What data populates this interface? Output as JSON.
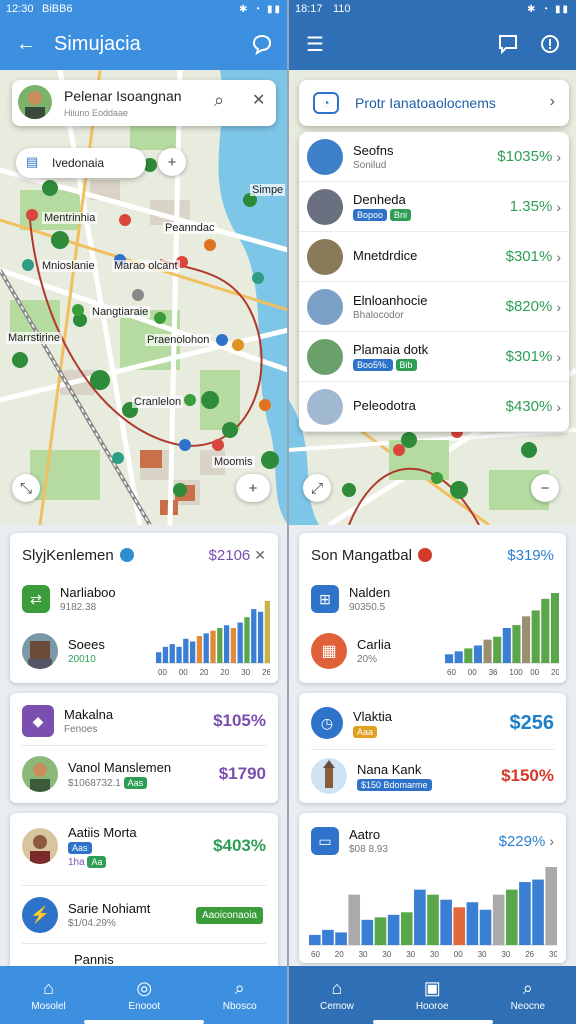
{
  "left": {
    "status": {
      "time": "12:30",
      "carrier": "BiBB6"
    },
    "appbar": {
      "title": "Simujacia"
    },
    "map": {
      "search_card": {
        "title": "Pelenar Isoangnan",
        "subtitle": "Hiiuno Eoddaae"
      },
      "filter_chip": {
        "label": "Ivedonaia"
      },
      "labels": [
        "Mentrinhia",
        "Peanndac",
        "Mnioslanie",
        "Marao olcant",
        "Nangtiaraie",
        "Marrstirine",
        "Praenolohon",
        "Cranlelon",
        "Moomis",
        "Simpe"
      ]
    },
    "list": [
      {
        "title": "SlyjKenlemen",
        "value": "$2106",
        "accent": "#7a4fb0",
        "rows": [
          {
            "title": "Narliaboo",
            "subtitle": "9182.38"
          },
          {
            "title": "Soees",
            "subtitle": "20010"
          }
        ],
        "chart_data": {
          "type": "bar",
          "series_colors": [
            "#3b7fd4",
            "#3b7fd4",
            "#3b7fd4",
            "#3b7fd4",
            "#3b7fd4",
            "#3b7fd4",
            "#e08a3c",
            "#3b7fd4",
            "#e08a3c",
            "#5aa64a",
            "#3b7fd4",
            "#e08a3c",
            "#3b7fd4",
            "#5aa64a",
            "#3b7fd4",
            "#3b7fd4",
            "#c9b24a"
          ],
          "values": [
            8,
            12,
            14,
            12,
            18,
            16,
            20,
            22,
            24,
            26,
            28,
            26,
            30,
            34,
            40,
            38,
            46
          ],
          "x_ticks": [
            "00",
            "00",
            "20",
            "20",
            "30",
            "26"
          ]
        }
      },
      {
        "title": "Makalna",
        "subtitle": "Fenoes",
        "value": "$105%",
        "accent": "#7a4fb0",
        "rows": [
          {
            "title": "Vanol Manslemen",
            "subtitle": "$1068732.1",
            "badge": "Aas",
            "value": "$1790"
          }
        ]
      },
      {
        "title": "Aatiis Morta",
        "value": "$403%",
        "accent": "#2e9e56",
        "badges": [
          "Aas",
          "Aa"
        ],
        "subtitle": "1ha",
        "rows": [
          {
            "title": "Sarie Nohiamt",
            "subtitle": "$1/04.29%",
            "pill": "Aaoiconaoia"
          },
          {
            "title": "Pannis",
            "subtitle": ""
          }
        ]
      }
    ],
    "nav": [
      {
        "label": "Mosolel",
        "icon": "home-icon"
      },
      {
        "label": "Enooot",
        "icon": "circle-icon"
      },
      {
        "label": "Nbosco",
        "icon": "search-icon"
      }
    ]
  },
  "right": {
    "status": {
      "time": "18:17",
      "carrier": "110"
    },
    "panel_header": {
      "title": "Protr Ianatoaolocnems"
    },
    "panel_items": [
      {
        "title": "Seofns",
        "subtitle": "Sonilud",
        "value": "$1035%",
        "color": "#2e9e56"
      },
      {
        "title": "Denheda",
        "badges": [
          "Bopoo",
          "Bni"
        ],
        "value": "1.35%",
        "color": "#2e9e56"
      },
      {
        "title": "Mnetdrdice",
        "subtitle": "",
        "value": "$301%",
        "color": "#2e9e56"
      },
      {
        "title": "Elnloanhocie",
        "subtitle": "Bhalocodor",
        "value": "$820%",
        "color": "#2e9e56"
      },
      {
        "title": "Plamaia dotk",
        "badges": [
          "Boo5%.",
          "Bib"
        ],
        "value": "$301%",
        "color": "#2e9e56"
      },
      {
        "title": "Peleodotra",
        "subtitle": "",
        "value": "$430%",
        "color": "#2e9e56"
      }
    ],
    "list": [
      {
        "title": "Son Mangatbal",
        "value": "$319%",
        "accent": "#2e7fcf",
        "rows": [
          {
            "title": "Nalden",
            "subtitle": "90350.5"
          },
          {
            "title": "Carlia",
            "subtitle": "20%"
          }
        ],
        "chart_data": {
          "type": "bar",
          "series_colors": [
            "#3b7fd4",
            "#3b7fd4",
            "#5aa64a",
            "#3b7fd4",
            "#9a8f70",
            "#5aa64a",
            "#3b7fd4",
            "#5aa64a",
            "#9a8f70",
            "#5aa64a",
            "#5aa64a",
            "#5aa64a"
          ],
          "values": [
            6,
            8,
            10,
            12,
            16,
            18,
            24,
            26,
            32,
            36,
            44,
            48
          ],
          "x_ticks": [
            "60",
            "00",
            "36",
            "100",
            "00",
            "200"
          ]
        }
      },
      {
        "title": "Vlaktia",
        "badge": "Aaa",
        "value": "$256",
        "accent": "#2e7fcf",
        "rows": [
          {
            "title": "Nana Kank",
            "pill": "$150 Bdomarme",
            "value": "$150%"
          }
        ]
      },
      {
        "title": "Aatro",
        "subtitle": "$08 8.93",
        "value": "$229%",
        "accent": "#2e7fcf",
        "chart_data": {
          "type": "bar",
          "series_colors": [
            "#3b7fd4",
            "#3b7fd4",
            "#3b7fd4",
            "#aaa",
            "#3b7fd4",
            "#5aa64a",
            "#3b7fd4",
            "#5aa64a",
            "#3b7fd4",
            "#5aa64a",
            "#3b7fd4",
            "#e06a3c",
            "#3b7fd4",
            "#3b7fd4",
            "#aaa",
            "#5aa64a",
            "#3b7fd4",
            "#3b7fd4",
            "#aaa"
          ],
          "values": [
            8,
            12,
            10,
            40,
            20,
            22,
            24,
            26,
            44,
            40,
            36,
            30,
            34,
            28,
            40,
            44,
            50,
            52,
            62
          ],
          "x_ticks": [
            "60",
            "20",
            "30",
            "30",
            "30",
            "30",
            "00",
            "30",
            "30",
            "26",
            "30"
          ]
        }
      }
    ],
    "nav": [
      {
        "label": "Cemow",
        "icon": "home-icon"
      },
      {
        "label": "Hooroe",
        "icon": "camera-icon"
      },
      {
        "label": "Neocne",
        "icon": "search-icon"
      }
    ]
  },
  "colors": {
    "primary_left": "#3d8fe0",
    "primary_right": "#2f6fb6",
    "positive": "#2e9e56",
    "negative": "#d23a2a",
    "accent_purple": "#7a4fb0"
  }
}
